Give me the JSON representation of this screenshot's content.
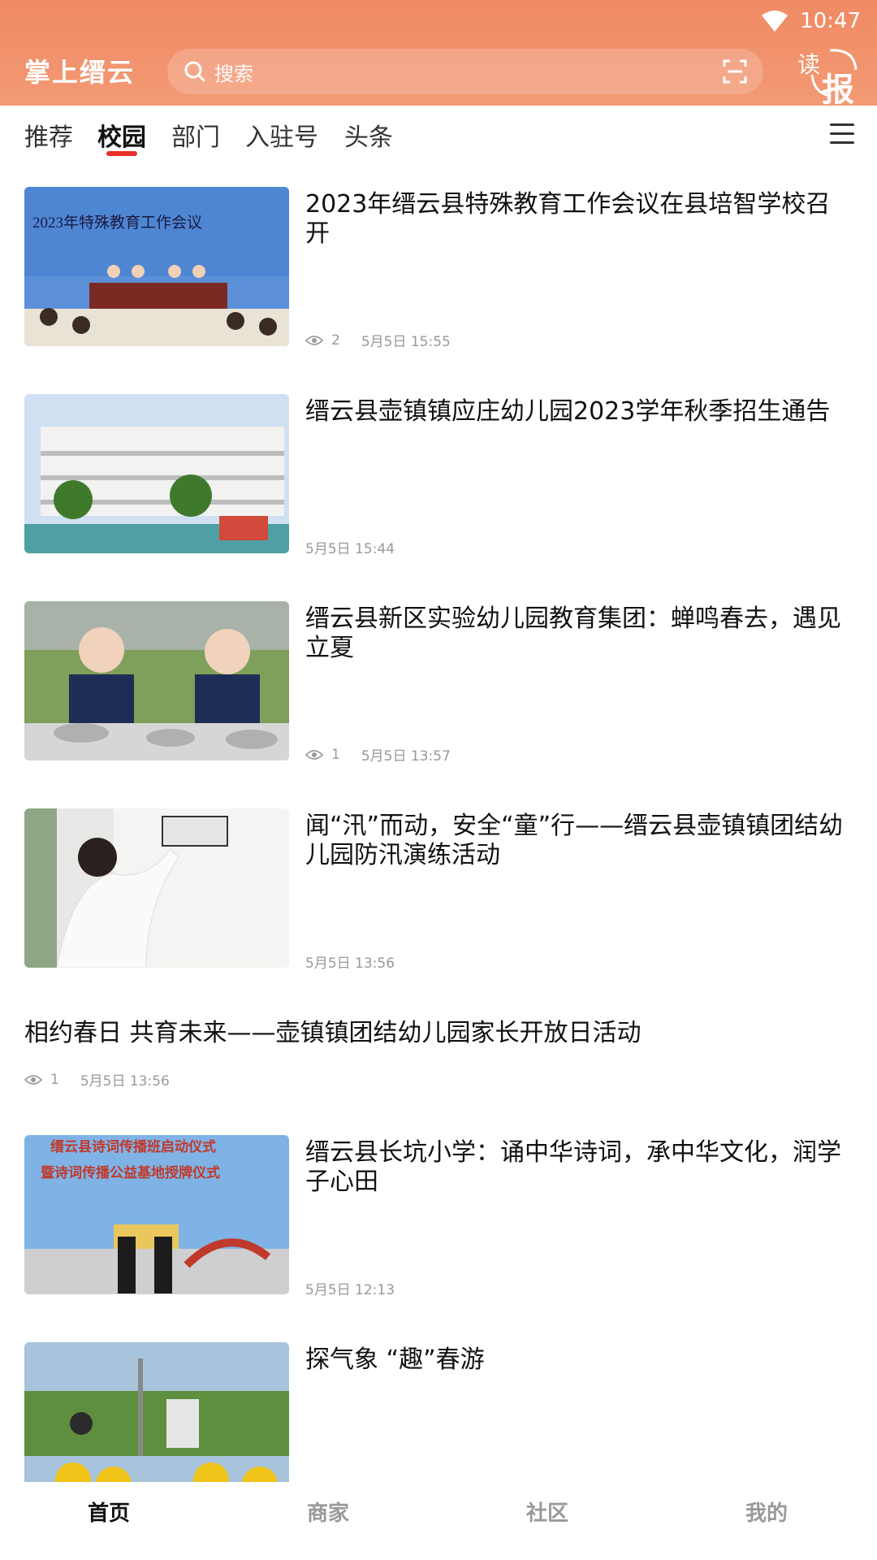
{
  "status": {
    "time": "10:47"
  },
  "header": {
    "app_title": "掌上缙云",
    "search_placeholder": "搜索",
    "read_paper_char1": "读",
    "read_paper_char2": "报",
    "bg_color": "#f08b66"
  },
  "tabs": [
    {
      "label": "推荐"
    },
    {
      "label": "校园",
      "active": true
    },
    {
      "label": "部门"
    },
    {
      "label": "入驻号"
    },
    {
      "label": "头条"
    }
  ],
  "news": [
    {
      "title": "2023年缙云县特殊教育工作会议在县培智学校召开",
      "views": "2",
      "time": "5月5日 15:55",
      "thumb_text": "2023年特殊教育工作会议"
    },
    {
      "title": "缙云县壶镇镇应庄幼儿园2023学年秋季招生通告",
      "time": "5月5日 15:44"
    },
    {
      "title": "缙云县新区实验幼儿园教育集团：蝉鸣春去，遇见立夏",
      "views": "1",
      "time": "5月5日 13:57"
    },
    {
      "title": "闻“汛”而动，安全“童”行——缙云县壶镇镇团结幼儿园防汛演练活动",
      "time": "5月5日 13:56"
    },
    {
      "title": "相约春日 共育未来——壶镇镇团结幼儿园家长开放日活动",
      "views": "1",
      "time": "5月5日 13:56"
    },
    {
      "title": "缙云县长坑小学：诵中华诗词，承中华文化，润学子心田",
      "time": "5月5日 12:13",
      "thumb_text": "缙云县诗词传播班启动仪式",
      "thumb_text2": "暨诗词传播公益基地授牌仪式"
    },
    {
      "title": "探气象 “趣”春游"
    }
  ],
  "bottom_nav": [
    {
      "label": "首页",
      "active": true
    },
    {
      "label": "商家"
    },
    {
      "label": "社区"
    },
    {
      "label": "我的"
    }
  ],
  "colors": {
    "accent": "#e8302a",
    "meta": "#999999"
  }
}
